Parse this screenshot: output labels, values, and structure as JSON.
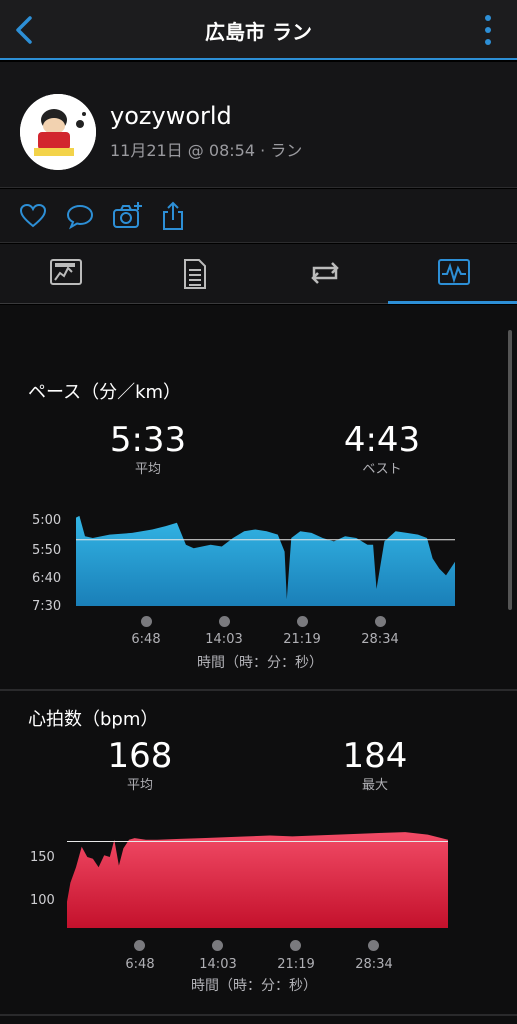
{
  "header": {
    "title": "広島市 ラン"
  },
  "profile": {
    "username": "yozyworld",
    "subtitle": "11月21日 @ 08:54 · ラン"
  },
  "actions": [
    "heart-icon",
    "comment-icon",
    "add-photo-icon",
    "share-icon"
  ],
  "tabs": [
    "overview-tab",
    "details-tab",
    "laps-tab",
    "charts-tab"
  ],
  "colors": {
    "accent": "#2d8fd6",
    "pace": "#2aa7d9",
    "heart": "#e0334f"
  },
  "pace": {
    "title": "ペース（分／km）",
    "avg_value": "5:33",
    "avg_label": "平均",
    "best_value": "4:43",
    "best_label": "ベスト",
    "yticks": [
      "5:00",
      "5:50",
      "6:40",
      "7:30"
    ],
    "xticks": [
      "6:48",
      "14:03",
      "21:19",
      "28:34"
    ],
    "xlabel": "時間（時：分：秒）"
  },
  "hr": {
    "title": "心拍数（bpm）",
    "avg_value": "168",
    "avg_label": "平均",
    "max_value": "184",
    "max_label": "最大",
    "yticks": [
      "150",
      "100"
    ],
    "xticks": [
      "6:48",
      "14:03",
      "21:19",
      "28:34"
    ],
    "xlabel": "時間（時：分：秒）"
  },
  "chart_data": [
    {
      "type": "area",
      "xlabel": "時間（時：分：秒）",
      "y_unit": "min/km",
      "y_reversed": true,
      "yticks": [
        "5:00",
        "5:50",
        "6:40",
        "7:30"
      ],
      "xticks": [
        "6:48",
        "14:03",
        "21:19",
        "28:34"
      ],
      "avg_line": "5:33",
      "x_minutes": [
        0,
        0.3,
        0.8,
        1.5,
        3,
        5,
        6.8,
        8,
        9,
        9.8,
        10.5,
        12,
        13,
        14,
        15,
        16,
        17,
        18,
        18.6,
        18.8,
        19.2,
        20,
        21,
        22,
        23,
        24,
        25,
        26,
        26.5,
        26.8,
        27.5,
        28.5,
        29.5,
        30.5,
        31.3,
        31.8,
        32.4,
        33,
        33.8
      ],
      "pace_min_per_km": [
        4.9,
        4.85,
        5.45,
        5.5,
        5.4,
        5.35,
        5.25,
        5.15,
        5.05,
        5.7,
        5.8,
        5.7,
        5.75,
        5.5,
        5.3,
        5.25,
        5.3,
        5.4,
        5.9,
        7.3,
        5.5,
        5.3,
        5.35,
        5.5,
        5.6,
        5.45,
        5.5,
        5.7,
        5.7,
        7.0,
        5.6,
        5.3,
        5.35,
        5.4,
        5.5,
        6.1,
        6.4,
        6.6,
        6.2
      ]
    },
    {
      "type": "area",
      "xlabel": "時間（時：分：秒）",
      "y_unit": "bpm",
      "yticks": [
        "150",
        "100"
      ],
      "xticks": [
        "6:48",
        "14:03",
        "21:19",
        "28:34"
      ],
      "avg_line": 168,
      "x_minutes": [
        0,
        0.3,
        0.8,
        1.3,
        1.8,
        2.3,
        2.8,
        3.3,
        3.8,
        4.2,
        4.6,
        5.0,
        5.5,
        6.0,
        7,
        8,
        10,
        12,
        14,
        16,
        18,
        20,
        22,
        24,
        26,
        28,
        30,
        32,
        33.8
      ],
      "bpm": [
        98,
        120,
        138,
        162,
        150,
        148,
        138,
        152,
        150,
        170,
        140,
        160,
        170,
        172,
        170,
        170,
        171,
        172,
        173,
        174,
        175,
        174,
        175,
        176,
        177,
        178,
        179,
        176,
        170
      ]
    }
  ]
}
